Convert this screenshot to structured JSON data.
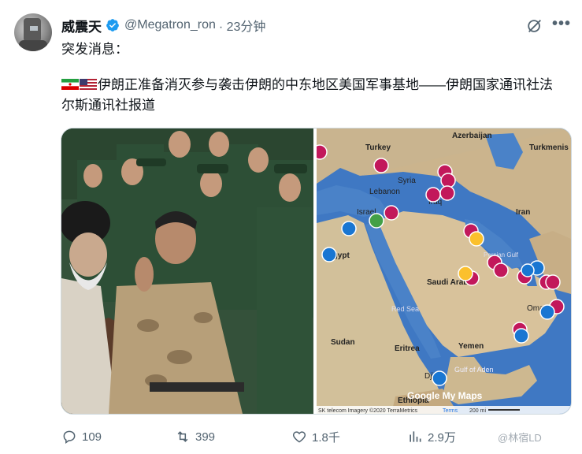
{
  "tweet": {
    "author_name": "威震天",
    "handle": "@Megatron_ron",
    "time": "· 23分钟",
    "line1": "突发消息：",
    "body": "伊朗正准备消灭参与袭击伊朗的中东地区美国军事基地——伊朗国家通讯社法尔斯通讯社报道"
  },
  "map": {
    "labels": [
      "Azerbaijan",
      "Turkmenis",
      "Turkey",
      "Syria",
      "Lebanon",
      "Israel",
      "Iraq",
      "Iran",
      "Egypt",
      "Saudi Arabia",
      "Persian Gulf",
      "Oman",
      "Red Sea",
      "Sudan",
      "Eritrea",
      "Yemen",
      "Gulf of Aden",
      "Djib",
      "Ethiopia"
    ],
    "logo": "Google My Maps",
    "footer": "SK telecom Imagery ©2020 TerraMetrics",
    "terms": "Terms",
    "scale": "200 mi"
  },
  "actions": {
    "replies": "109",
    "retweets": "399",
    "likes": "1.8千",
    "views": "2.9万"
  },
  "watermark": "@林宿LD",
  "colors": {
    "verified": "#1d9bf0",
    "pin_base": "#c2185b",
    "pin_port": "#1976d2",
    "pin_star": "#fbc02d"
  }
}
